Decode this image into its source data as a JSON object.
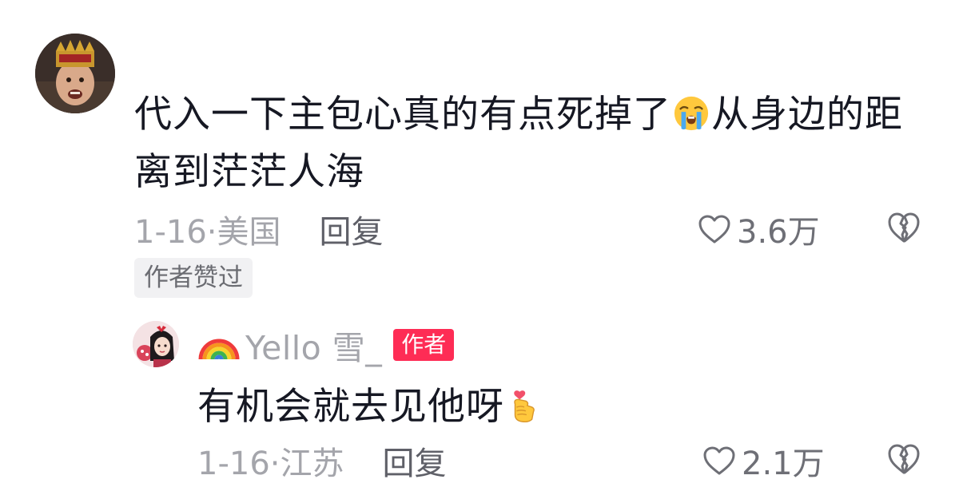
{
  "comment": {
    "text_part1": "代入一下主包心真的有点死掉了",
    "emoji": "loudly-crying-face-icon",
    "text_part2": "从身边的距离到茫茫人海",
    "date_location": "1-16·美国",
    "reply_label": "回复",
    "like_count": "3.6万",
    "author_liked_badge": "作者赞过"
  },
  "reply": {
    "username": "Yello 雪_",
    "author_tag": "作者",
    "text": "有机会就去见他呀",
    "emoji": "finger-heart-icon",
    "date_location": "1-16·江苏",
    "reply_label": "回复",
    "like_count": "2.1万"
  },
  "colors": {
    "primary_text": "#161823",
    "secondary_text": "#a4a5ab",
    "author_tag_bg": "#fe2c55",
    "badge_bg": "#f1f1f3"
  }
}
